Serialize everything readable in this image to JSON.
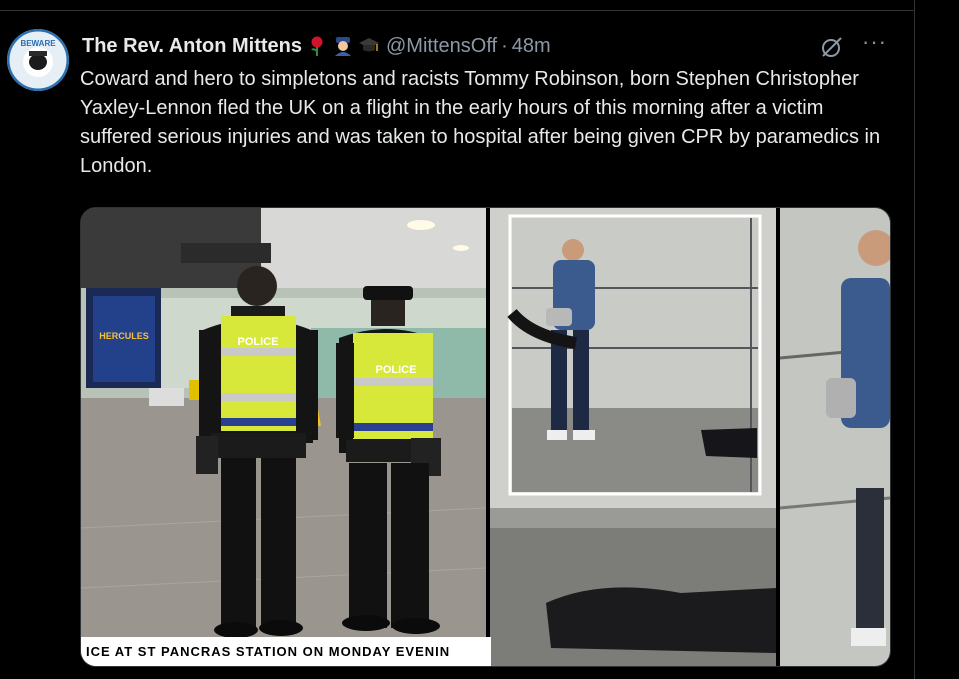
{
  "tweet": {
    "author_name": "The Rev. Anton Mittens",
    "handle": "@MittensOff",
    "separator": "·",
    "timestamp": "48m",
    "badges": [
      "rose-emoji",
      "police-officer-emoji",
      "graduation-cap-emoji"
    ],
    "avatar_text": "BEWARE",
    "more_label": "···",
    "text": "Coward and hero to simpletons and racists Tommy Robinson, born Stephen Christopher Yaxley-Lennon fled the UK on a flight in the early hours of this morning after a victim suffered serious injuries and was taken to hospital after being given CPR by paramedics in London."
  },
  "media": {
    "caption": "ICE AT ST PANCRAS STATION ON MONDAY EVENIN",
    "poster_title": "HERCULES",
    "vest_label_left": "POLICE",
    "vest_label_right": "POLICE"
  },
  "colors": {
    "background": "#000000",
    "text_primary": "#e7e9ea",
    "text_secondary": "#8b98a5",
    "border": "#2f3336",
    "hi_vis": "#d7e83a"
  }
}
